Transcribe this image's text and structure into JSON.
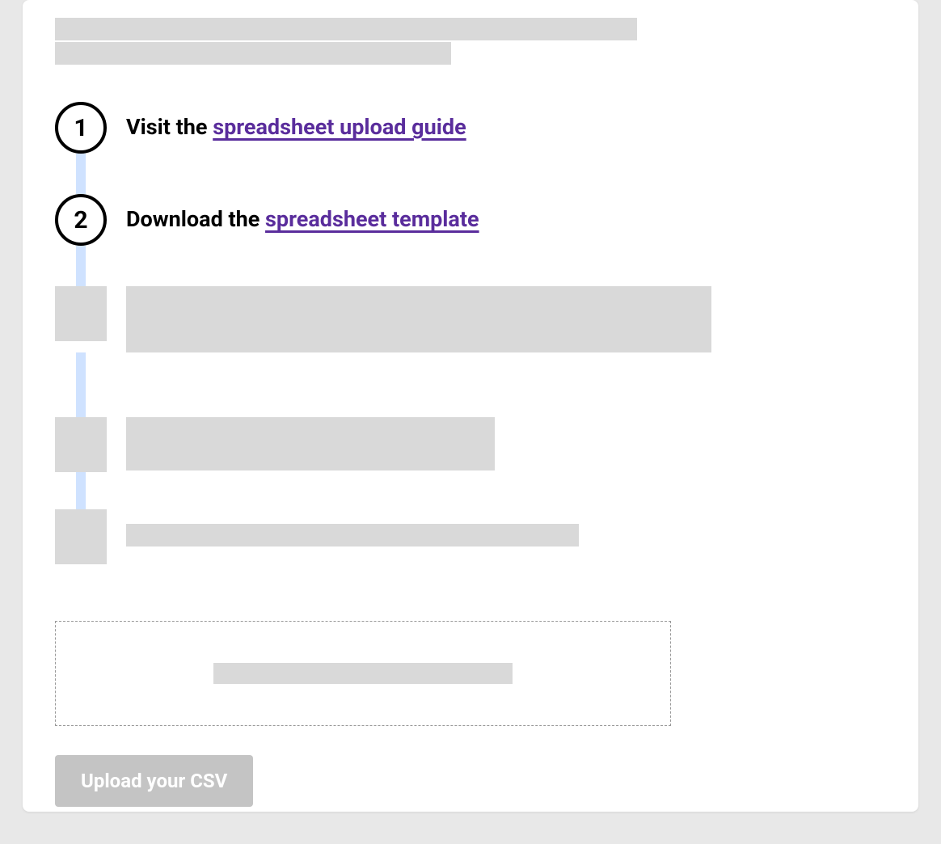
{
  "steps": {
    "step1": {
      "number": "1",
      "prefix": "Visit the ",
      "link_text": "spreadsheet upload guide"
    },
    "step2": {
      "number": "2",
      "prefix": "Download the ",
      "link_text": "spreadsheet template"
    }
  },
  "upload": {
    "button_label": "Upload your CSV"
  }
}
